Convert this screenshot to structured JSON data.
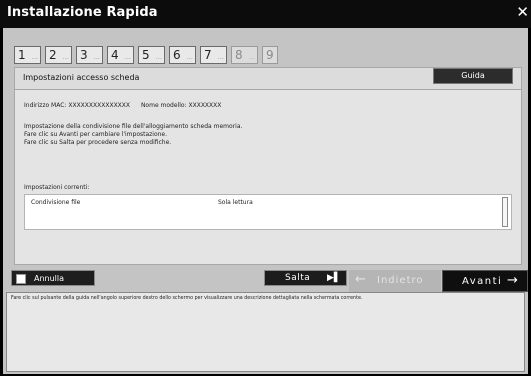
{
  "window": {
    "title": "Installazione Rapida",
    "close_icon": "close-icon"
  },
  "steps": [
    {
      "number": "1",
      "suffix": "...",
      "state": "done"
    },
    {
      "number": "2",
      "suffix": "...",
      "state": "done"
    },
    {
      "number": "3",
      "suffix": "...",
      "state": "done"
    },
    {
      "number": "4",
      "suffix": "...",
      "state": "done"
    },
    {
      "number": "5",
      "suffix": "...",
      "state": "done"
    },
    {
      "number": "6",
      "suffix": "...",
      "state": "done"
    },
    {
      "number": "7",
      "suffix": "...",
      "state": "current"
    },
    {
      "number": "8",
      "suffix": "...",
      "state": "pending"
    },
    {
      "number": "9",
      "suffix": "",
      "state": "pending"
    }
  ],
  "section": {
    "title": "Impostazioni accesso scheda",
    "guida_label": "Guida"
  },
  "device": {
    "mac_label": "Indirizzo MAC: XXXXXXXXXXXXXXX",
    "model_label": "Nome modello: XXXXXXXX"
  },
  "description": {
    "line1": "Impostazione della condivisione file dell'alloggiamento scheda memoria.",
    "line2": "Fare clic su Avanti per cambiare l'impostazione.",
    "line3": "Fare clic su Salta per procedere senza modifiche."
  },
  "current": {
    "label": "Impostazioni correnti:",
    "setting_name": "Condivisione file",
    "setting_value": "Sola lettura"
  },
  "buttons": {
    "annulla": "Annulla",
    "salta": "Salta",
    "indietro": "Indietro",
    "avanti": "Avanti"
  },
  "help": {
    "text": "Fare clic sul pulsante della guida nell'angolo superiore destro dello schermo per visualizzare una descrizione dettagliata nella schermata corrente."
  },
  "colors": {
    "titlebar": "#0c0c0c",
    "panel": "#c4c4c4",
    "content": "#e4e4e4",
    "button_dark": "#1c1c1c",
    "button_disabled": "#b5b5b5"
  }
}
